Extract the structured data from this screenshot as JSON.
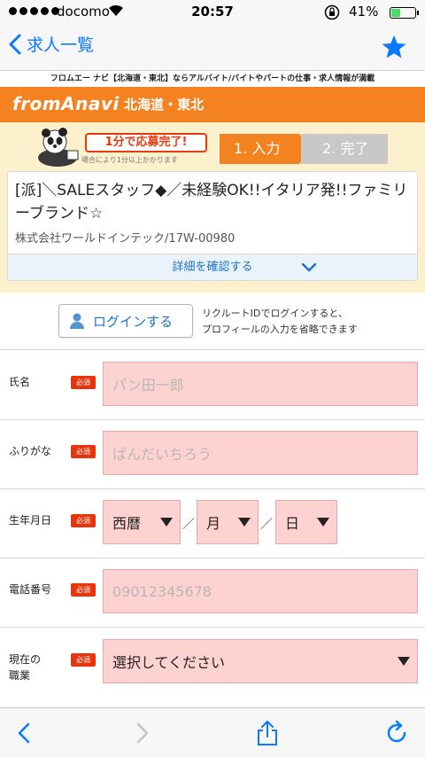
{
  "status": {
    "carrier": "docomo",
    "time": "20:57",
    "battery": "41%",
    "battery_level": 0.41
  },
  "nav": {
    "back_label": "求人一覧"
  },
  "tagline": "フロムエー ナビ【北海道・東北】ならアルバイト/バイトやパートの仕事・求人情報が満載",
  "brand": {
    "logo": "fromAnavi",
    "region": "北海道・東北"
  },
  "steps": {
    "promo": "1分で応募完了!",
    "promo_note": "場合により1分以上かかります",
    "step1": "1. 入力",
    "step2": "2. 完了"
  },
  "job": {
    "title": "[派]＼SALEスタッフ◆／未経験OK!!イタリア発!!ファミリーブランド☆",
    "company": "株式会社ワールドインテック/17W-00980",
    "detail_label": "詳細を確認する"
  },
  "login": {
    "button_label": "ログインする",
    "note_line1": "リクルートIDでログインすると、",
    "note_line2": "プロフィールの入力を省略できます"
  },
  "form": {
    "required_badge": "必須",
    "name": {
      "label": "氏名",
      "placeholder": "パン田一郎"
    },
    "kana": {
      "label": "ふりがな",
      "placeholder": "ぱんだいちろう"
    },
    "birth": {
      "label": "生年月日",
      "era": "西暦",
      "month": "月",
      "day": "日",
      "sep": "／"
    },
    "phone": {
      "label": "電話番号",
      "placeholder": "09012345678"
    },
    "job_status": {
      "label_line1": "現在の",
      "label_line2": "職業",
      "value": "選択してください"
    }
  },
  "colors": {
    "accent": "#0a7aff",
    "brand_orange": "#f58220",
    "required_red": "#e8340c",
    "field_bg": "#ffd2d2"
  }
}
